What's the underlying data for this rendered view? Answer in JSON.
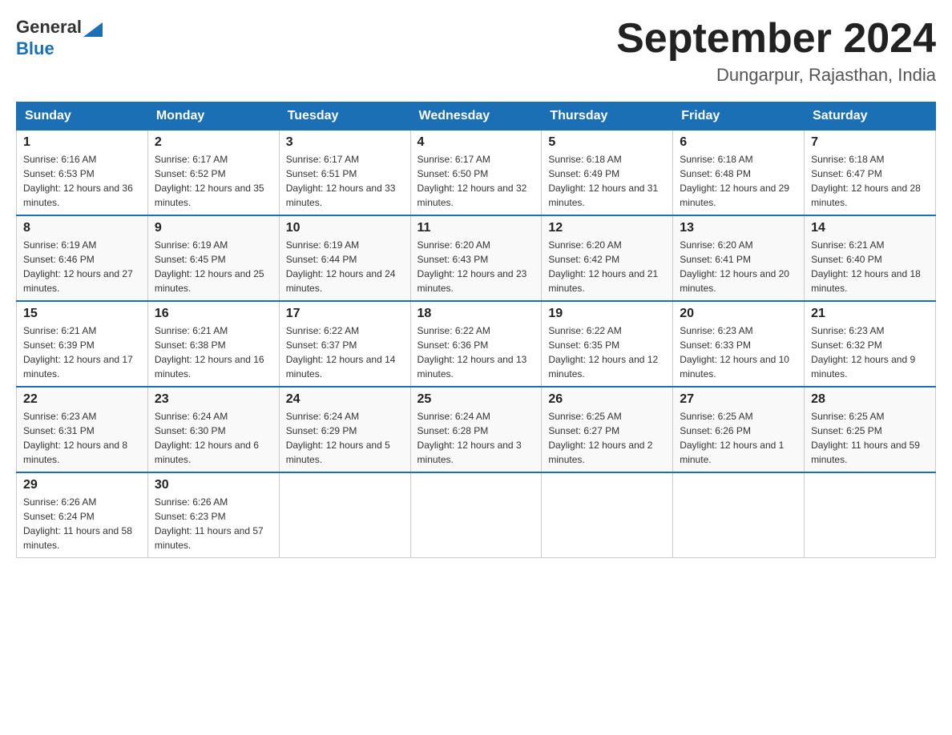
{
  "logo": {
    "general": "General",
    "blue": "Blue"
  },
  "title": "September 2024",
  "subtitle": "Dungarpur, Rajasthan, India",
  "days_of_week": [
    "Sunday",
    "Monday",
    "Tuesday",
    "Wednesday",
    "Thursday",
    "Friday",
    "Saturday"
  ],
  "weeks": [
    [
      {
        "day": "1",
        "sunrise": "6:16 AM",
        "sunset": "6:53 PM",
        "daylight": "12 hours and 36 minutes."
      },
      {
        "day": "2",
        "sunrise": "6:17 AM",
        "sunset": "6:52 PM",
        "daylight": "12 hours and 35 minutes."
      },
      {
        "day": "3",
        "sunrise": "6:17 AM",
        "sunset": "6:51 PM",
        "daylight": "12 hours and 33 minutes."
      },
      {
        "day": "4",
        "sunrise": "6:17 AM",
        "sunset": "6:50 PM",
        "daylight": "12 hours and 32 minutes."
      },
      {
        "day": "5",
        "sunrise": "6:18 AM",
        "sunset": "6:49 PM",
        "daylight": "12 hours and 31 minutes."
      },
      {
        "day": "6",
        "sunrise": "6:18 AM",
        "sunset": "6:48 PM",
        "daylight": "12 hours and 29 minutes."
      },
      {
        "day": "7",
        "sunrise": "6:18 AM",
        "sunset": "6:47 PM",
        "daylight": "12 hours and 28 minutes."
      }
    ],
    [
      {
        "day": "8",
        "sunrise": "6:19 AM",
        "sunset": "6:46 PM",
        "daylight": "12 hours and 27 minutes."
      },
      {
        "day": "9",
        "sunrise": "6:19 AM",
        "sunset": "6:45 PM",
        "daylight": "12 hours and 25 minutes."
      },
      {
        "day": "10",
        "sunrise": "6:19 AM",
        "sunset": "6:44 PM",
        "daylight": "12 hours and 24 minutes."
      },
      {
        "day": "11",
        "sunrise": "6:20 AM",
        "sunset": "6:43 PM",
        "daylight": "12 hours and 23 minutes."
      },
      {
        "day": "12",
        "sunrise": "6:20 AM",
        "sunset": "6:42 PM",
        "daylight": "12 hours and 21 minutes."
      },
      {
        "day": "13",
        "sunrise": "6:20 AM",
        "sunset": "6:41 PM",
        "daylight": "12 hours and 20 minutes."
      },
      {
        "day": "14",
        "sunrise": "6:21 AM",
        "sunset": "6:40 PM",
        "daylight": "12 hours and 18 minutes."
      }
    ],
    [
      {
        "day": "15",
        "sunrise": "6:21 AM",
        "sunset": "6:39 PM",
        "daylight": "12 hours and 17 minutes."
      },
      {
        "day": "16",
        "sunrise": "6:21 AM",
        "sunset": "6:38 PM",
        "daylight": "12 hours and 16 minutes."
      },
      {
        "day": "17",
        "sunrise": "6:22 AM",
        "sunset": "6:37 PM",
        "daylight": "12 hours and 14 minutes."
      },
      {
        "day": "18",
        "sunrise": "6:22 AM",
        "sunset": "6:36 PM",
        "daylight": "12 hours and 13 minutes."
      },
      {
        "day": "19",
        "sunrise": "6:22 AM",
        "sunset": "6:35 PM",
        "daylight": "12 hours and 12 minutes."
      },
      {
        "day": "20",
        "sunrise": "6:23 AM",
        "sunset": "6:33 PM",
        "daylight": "12 hours and 10 minutes."
      },
      {
        "day": "21",
        "sunrise": "6:23 AM",
        "sunset": "6:32 PM",
        "daylight": "12 hours and 9 minutes."
      }
    ],
    [
      {
        "day": "22",
        "sunrise": "6:23 AM",
        "sunset": "6:31 PM",
        "daylight": "12 hours and 8 minutes."
      },
      {
        "day": "23",
        "sunrise": "6:24 AM",
        "sunset": "6:30 PM",
        "daylight": "12 hours and 6 minutes."
      },
      {
        "day": "24",
        "sunrise": "6:24 AM",
        "sunset": "6:29 PM",
        "daylight": "12 hours and 5 minutes."
      },
      {
        "day": "25",
        "sunrise": "6:24 AM",
        "sunset": "6:28 PM",
        "daylight": "12 hours and 3 minutes."
      },
      {
        "day": "26",
        "sunrise": "6:25 AM",
        "sunset": "6:27 PM",
        "daylight": "12 hours and 2 minutes."
      },
      {
        "day": "27",
        "sunrise": "6:25 AM",
        "sunset": "6:26 PM",
        "daylight": "12 hours and 1 minute."
      },
      {
        "day": "28",
        "sunrise": "6:25 AM",
        "sunset": "6:25 PM",
        "daylight": "11 hours and 59 minutes."
      }
    ],
    [
      {
        "day": "29",
        "sunrise": "6:26 AM",
        "sunset": "6:24 PM",
        "daylight": "11 hours and 58 minutes."
      },
      {
        "day": "30",
        "sunrise": "6:26 AM",
        "sunset": "6:23 PM",
        "daylight": "11 hours and 57 minutes."
      },
      null,
      null,
      null,
      null,
      null
    ]
  ]
}
